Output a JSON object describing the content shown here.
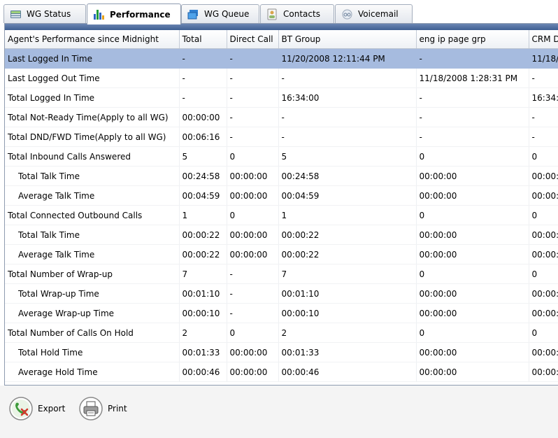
{
  "tabs": [
    {
      "label": "WG Status",
      "icon": "wg-status-icon"
    },
    {
      "label": "Performance",
      "icon": "bar-chart-icon"
    },
    {
      "label": "WG Queue",
      "icon": "queue-icon"
    },
    {
      "label": "Contacts",
      "icon": "contacts-icon"
    },
    {
      "label": "Voicemail",
      "icon": "voicemail-icon"
    }
  ],
  "table": {
    "columns": [
      "Agent's Performance since Midnight",
      "Total",
      "Direct Call",
      "BT Group",
      "eng ip page grp",
      "CRM D"
    ],
    "rows": [
      {
        "cells": [
          "Last Logged In Time",
          "-",
          "-",
          "11/20/2008 12:11:44 PM",
          "-",
          "11/18/"
        ],
        "indent": false,
        "selected": true
      },
      {
        "cells": [
          "Last Logged Out Time",
          "-",
          "-",
          "-",
          "11/18/2008 1:28:31 PM",
          "-"
        ],
        "indent": false
      },
      {
        "cells": [
          "Total Logged In Time",
          "-",
          "-",
          "16:34:00",
          "-",
          "16:34:"
        ],
        "indent": false
      },
      {
        "cells": [
          "Total Not-Ready Time(Apply to all WG)",
          "00:00:00",
          "-",
          "-",
          "-",
          "-"
        ],
        "indent": false
      },
      {
        "cells": [
          "Total DND/FWD Time(Apply to all WG)",
          "00:06:16",
          "-",
          "-",
          "-",
          "-"
        ],
        "indent": false
      },
      {
        "cells": [
          "Total Inbound Calls Answered",
          "5",
          "0",
          "5",
          "0",
          "0"
        ],
        "indent": false
      },
      {
        "cells": [
          "Total Talk Time",
          "00:24:58",
          "00:00:00",
          "00:24:58",
          "00:00:00",
          "00:00:"
        ],
        "indent": true
      },
      {
        "cells": [
          "Average Talk Time",
          "00:04:59",
          "00:00:00",
          "00:04:59",
          "00:00:00",
          "00:00:"
        ],
        "indent": true
      },
      {
        "cells": [
          "Total Connected Outbound Calls",
          "1",
          "0",
          "1",
          "0",
          "0"
        ],
        "indent": false
      },
      {
        "cells": [
          "Total Talk Time",
          "00:00:22",
          "00:00:00",
          "00:00:22",
          "00:00:00",
          "00:00:"
        ],
        "indent": true
      },
      {
        "cells": [
          "Average Talk Time",
          "00:00:22",
          "00:00:00",
          "00:00:22",
          "00:00:00",
          "00:00:"
        ],
        "indent": true
      },
      {
        "cells": [
          "Total Number of Wrap-up",
          "7",
          "-",
          "7",
          "0",
          "0"
        ],
        "indent": false
      },
      {
        "cells": [
          "Total Wrap-up Time",
          "00:01:10",
          "-",
          "00:01:10",
          "00:00:00",
          "00:00:"
        ],
        "indent": true
      },
      {
        "cells": [
          "Average Wrap-up Time",
          "00:00:10",
          "-",
          "00:00:10",
          "00:00:00",
          "00:00:"
        ],
        "indent": true
      },
      {
        "cells": [
          "Total Number of Calls On Hold",
          "2",
          "0",
          "2",
          "0",
          "0"
        ],
        "indent": false
      },
      {
        "cells": [
          "Total Hold Time",
          "00:01:33",
          "00:00:00",
          "00:01:33",
          "00:00:00",
          "00:00:"
        ],
        "indent": true
      },
      {
        "cells": [
          "Average Hold Time",
          "00:00:46",
          "00:00:00",
          "00:00:46",
          "00:00:00",
          "00:00:"
        ],
        "indent": true
      }
    ]
  },
  "actions": {
    "export_label": "Export",
    "print_label": "Print"
  },
  "colors": {
    "selected_row": "#a6bbdf",
    "header_band": "#3f5f92",
    "export_green": "#3c9a3a",
    "export_red": "#d23a2e"
  }
}
